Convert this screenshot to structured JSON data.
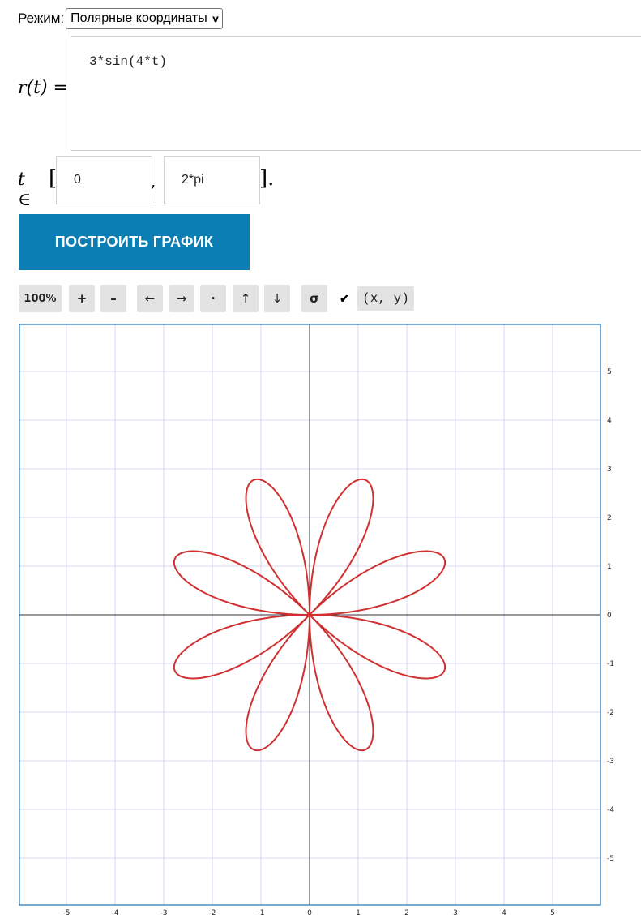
{
  "mode": {
    "label": "Режим:",
    "selected": "Полярные координаты"
  },
  "expression": {
    "lhs": "r(t) =",
    "value": "3*sin(4*t)"
  },
  "range": {
    "symbol": "t ∈",
    "open": "[",
    "comma": ",",
    "close": "].",
    "from": "0",
    "to": "2*pi"
  },
  "plot_button": "ПОСТРОИТЬ ГРАФИК",
  "toolbar": {
    "zoom": "100%",
    "zoom_in": "+",
    "zoom_out": "–",
    "left": "←",
    "right": "→",
    "center": "·",
    "up": "↑",
    "down": "↓",
    "reset": "σ",
    "coords_checked": true,
    "coords_label": "(x, y)"
  },
  "chart_data": {
    "type": "line",
    "function": "r = 3*sin(4*t)",
    "t_range": [
      0,
      6.2832
    ],
    "xlim": [
      -6,
      6
    ],
    "ylim": [
      -6,
      6
    ],
    "x_ticks": [
      -5,
      -4,
      -3,
      -2,
      -1,
      0,
      1,
      2,
      3,
      4,
      5
    ],
    "y_ticks": [
      5,
      4,
      3,
      2,
      1,
      0,
      -1,
      -2,
      -3,
      -4,
      -5
    ],
    "grid": true,
    "curve_color": "#d03030",
    "grid_color": "#d7d7f5",
    "axis_color": "#333333",
    "frame_color": "#1a73b8"
  }
}
